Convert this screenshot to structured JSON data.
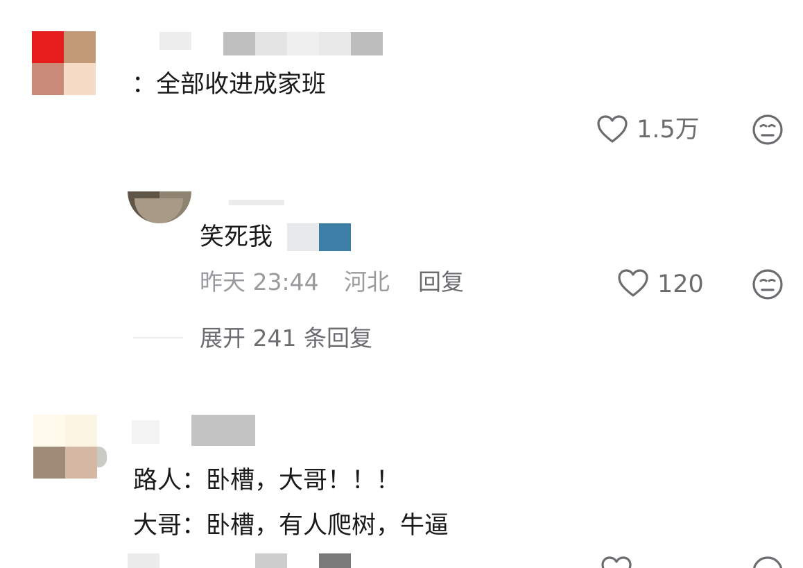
{
  "comments": [
    {
      "text": "：全部收进成家班",
      "likes": "1.5万"
    },
    {
      "text": "笑死我",
      "time": "昨天 23:44",
      "location": "河北",
      "reply_label": "回复",
      "likes": "120",
      "expand_label": "展开 241 条回复"
    },
    {
      "lines": [
        "路人：卧槽，大哥！！！",
        "大哥：卧槽，有人爬树，牛逼"
      ]
    }
  ],
  "icons": {
    "like": "heart-outline-icon",
    "dislike": "neutral-face-icon"
  },
  "colors": {
    "text": "#1a1a1a",
    "secondary": "#6b6b70",
    "meta": "#9a9a9e"
  }
}
